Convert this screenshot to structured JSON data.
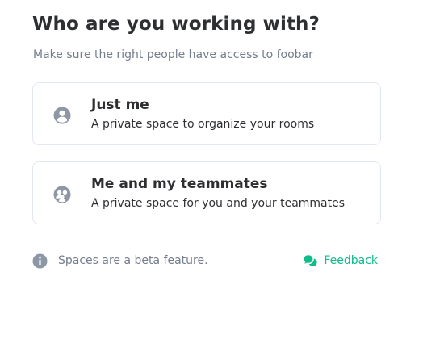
{
  "dialog": {
    "title": "Who are you working with?",
    "subtitle": "Make sure the right people have access to foobar"
  },
  "options": [
    {
      "name": "Just me",
      "description": "A private space to organize your rooms",
      "icon": "person-icon"
    },
    {
      "name": "Me and my teammates",
      "description": "A private space for you and your teammates",
      "icon": "group-icon"
    }
  ],
  "footer": {
    "beta_note": "Spaces are a beta feature.",
    "feedback_label": "Feedback",
    "info_icon": "info-icon",
    "feedback_icon": "chat-bubbles-icon"
  },
  "colors": {
    "accent": "#0dbd8b",
    "text_primary": "#2e2f32",
    "text_secondary": "#737d8c",
    "icon_gray": "#8d97a5",
    "border": "#e3e8f0"
  }
}
